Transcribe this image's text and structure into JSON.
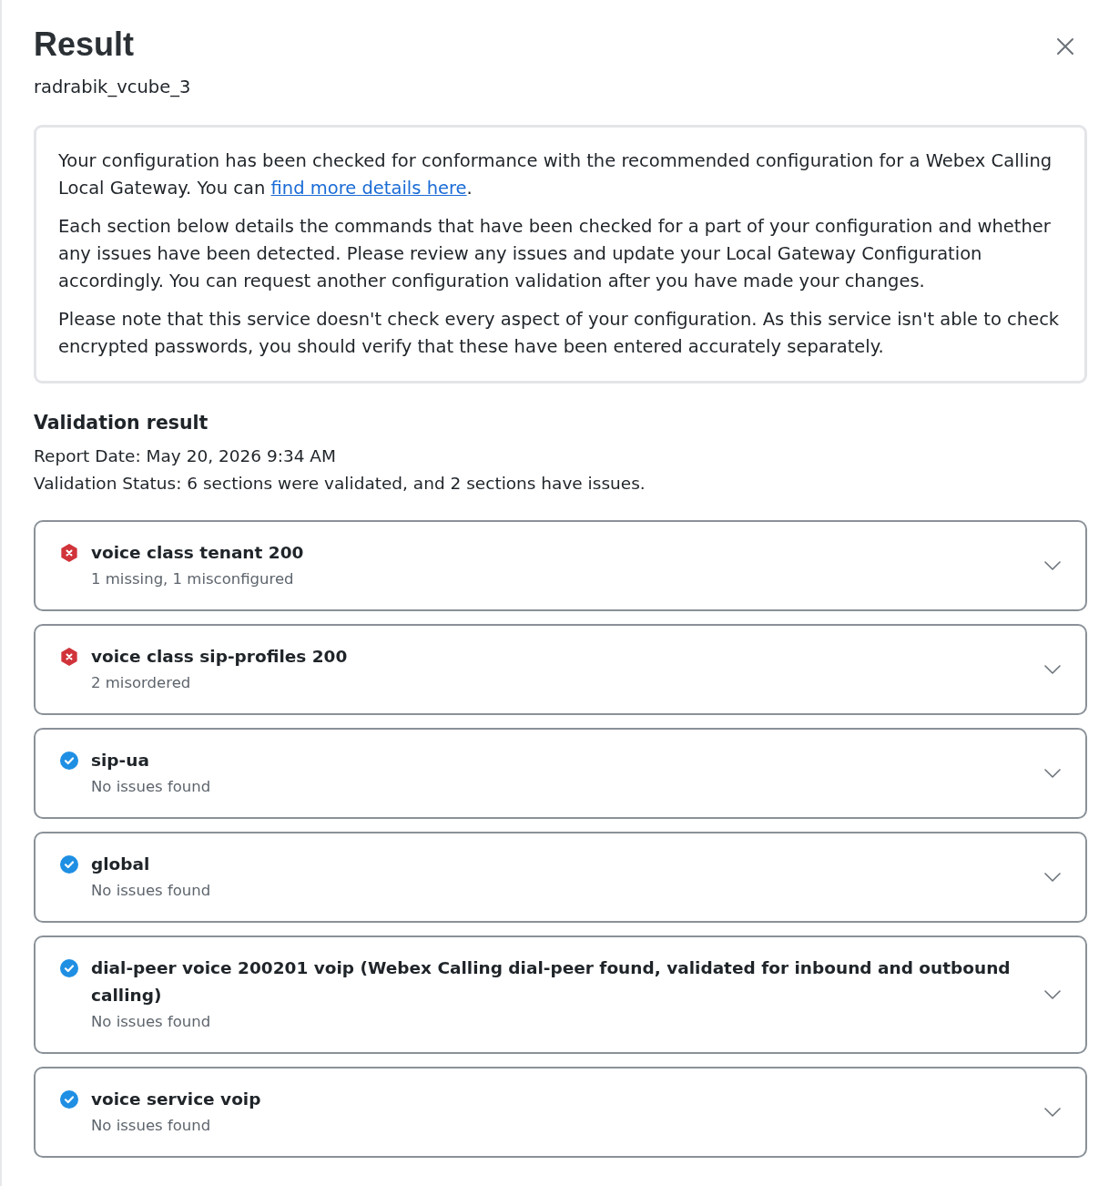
{
  "header": {
    "title": "Result",
    "subtitle": "radrabik_vcube_3"
  },
  "info": {
    "paragraphs": [
      {
        "text": "Your configuration has been checked for conformance with the recommended configuration for a Webex Calling Local Gateway. You can ",
        "link": "find more details here",
        "after": "."
      },
      {
        "text": "Each section below details the commands that have been checked for a part of your configuration and whether any issues have been detected. Please review any issues and update your Local Gateway Configuration accordingly. You can request another configuration validation after you have made your changes."
      },
      {
        "text": "Please note that this service doesn't check every aspect of your configuration. As this service isn't able to check encrypted passwords, you should verify that these have been entered accurately separately."
      }
    ]
  },
  "validation": {
    "heading": "Validation result",
    "report_date": "Report Date: May 20, 2026 9:34 AM",
    "status": "Validation Status: 6 sections were validated, and 2 sections have issues."
  },
  "sections": [
    {
      "kind": "error",
      "title": "voice class tenant 200",
      "summary": "1 missing, 1 misconfigured",
      "expanded": false
    },
    {
      "kind": "error",
      "title": "voice class sip-profiles 200",
      "summary": "2 misordered",
      "expanded": false
    },
    {
      "kind": "ok",
      "title": "sip-ua",
      "summary": "No issues found",
      "expanded": false
    },
    {
      "kind": "ok",
      "title": "global",
      "summary": "No issues found",
      "expanded": false
    },
    {
      "kind": "ok",
      "title": "dial-peer voice 200201 voip (Webex Calling dial-peer found, validated for inbound and outbound calling)",
      "summary": "No issues found",
      "expanded": false
    },
    {
      "kind": "ok",
      "title": "voice service voip",
      "summary": "No issues found",
      "expanded": false
    }
  ]
}
